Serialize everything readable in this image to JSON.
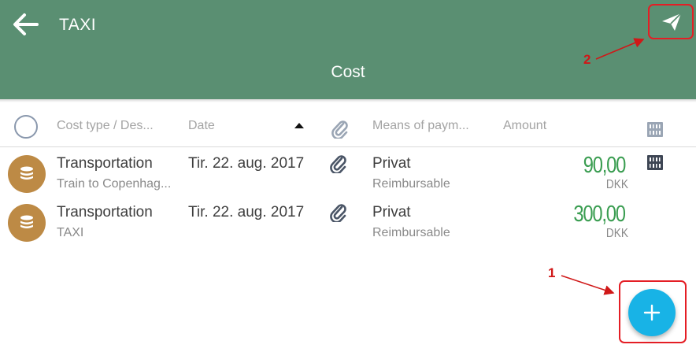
{
  "header": {
    "title": "TAXI",
    "subtitle": "Cost"
  },
  "columns": {
    "cost_type": "Cost type / Des...",
    "date": "Date",
    "means_of_payment": "Means of paym...",
    "amount": "Amount"
  },
  "rows": [
    {
      "cost_type": "Transportation",
      "description": "Train to Copenhag...",
      "date": "Tir. 22. aug. 2017",
      "payment": "Privat",
      "reimbursable": "Reimbursable",
      "amount": "90,00",
      "currency": "DKK"
    },
    {
      "cost_type": "Transportation",
      "description": "TAXI",
      "date": "Tir. 22. aug. 2017",
      "payment": "Privat",
      "reimbursable": "Reimbursable",
      "amount": "300,00",
      "currency": "DKK"
    }
  ],
  "annotations": {
    "add_callout": "1",
    "send_callout": "2"
  },
  "colors": {
    "header": "#5a8f72",
    "category_icon": "#bd8a45",
    "amount": "#3a9d51",
    "fab": "#18b3e6",
    "callout": "#e41e25"
  },
  "icons": [
    "back-arrow-icon",
    "send-plane-icon",
    "paperclip-icon",
    "barcode-icon",
    "coins-icon",
    "plus-icon",
    "sort-up-icon"
  ]
}
